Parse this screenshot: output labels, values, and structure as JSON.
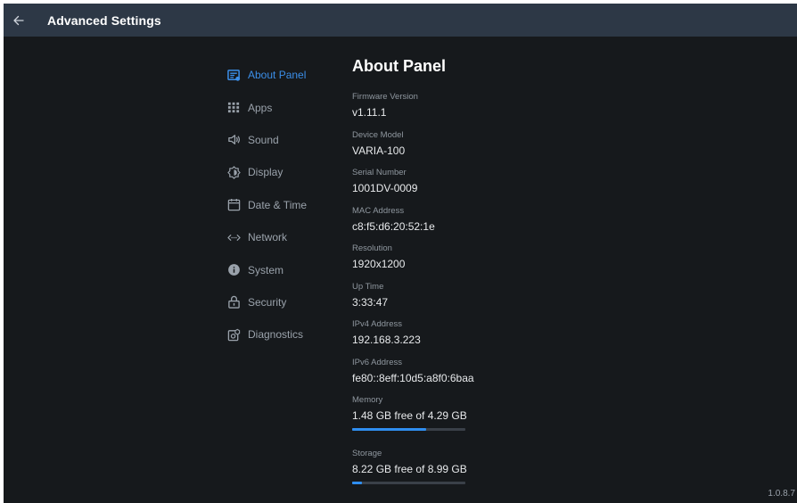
{
  "header": {
    "title": "Advanced Settings"
  },
  "sidebar": {
    "items": [
      {
        "label": "About Panel",
        "icon": "about-panel-icon",
        "active": true
      },
      {
        "label": "Apps",
        "icon": "apps-grid-icon"
      },
      {
        "label": "Sound",
        "icon": "speaker-icon"
      },
      {
        "label": "Display",
        "icon": "brightness-icon"
      },
      {
        "label": "Date & Time",
        "icon": "calendar-icon"
      },
      {
        "label": "Network",
        "icon": "network-arrows-icon"
      },
      {
        "label": "System",
        "icon": "info-icon"
      },
      {
        "label": "Security",
        "icon": "lock-icon"
      },
      {
        "label": "Diagnostics",
        "icon": "diagnostics-icon"
      }
    ]
  },
  "main": {
    "title": "About Panel",
    "fields": [
      {
        "label": "Firmware Version",
        "value": "v1.11.1"
      },
      {
        "label": "Device Model",
        "value": "VARIA-100"
      },
      {
        "label": "Serial Number",
        "value": "1001DV-0009"
      },
      {
        "label": "MAC Address",
        "value": "c8:f5:d6:20:52:1e"
      },
      {
        "label": "Resolution",
        "value": "1920x1200"
      },
      {
        "label": "Up Time",
        "value": "3:33:47"
      },
      {
        "label": "IPv4 Address",
        "value": "192.168.3.223"
      },
      {
        "label": "IPv6 Address",
        "value": "fe80::8eff:10d5:a8f0:6baa"
      }
    ],
    "memory": {
      "label": "Memory",
      "value": "1.48 GB free of 4.29 GB",
      "used_fraction": 0.655
    },
    "storage": {
      "label": "Storage",
      "value": "8.22 GB free of 8.99 GB",
      "used_fraction": 0.085
    }
  },
  "footer": {
    "version": "1.0.8.7"
  },
  "colors": {
    "accent": "#3b8ee8",
    "topbar": "#2d3846",
    "background": "#16191c",
    "progress": "#2f8ef0"
  }
}
